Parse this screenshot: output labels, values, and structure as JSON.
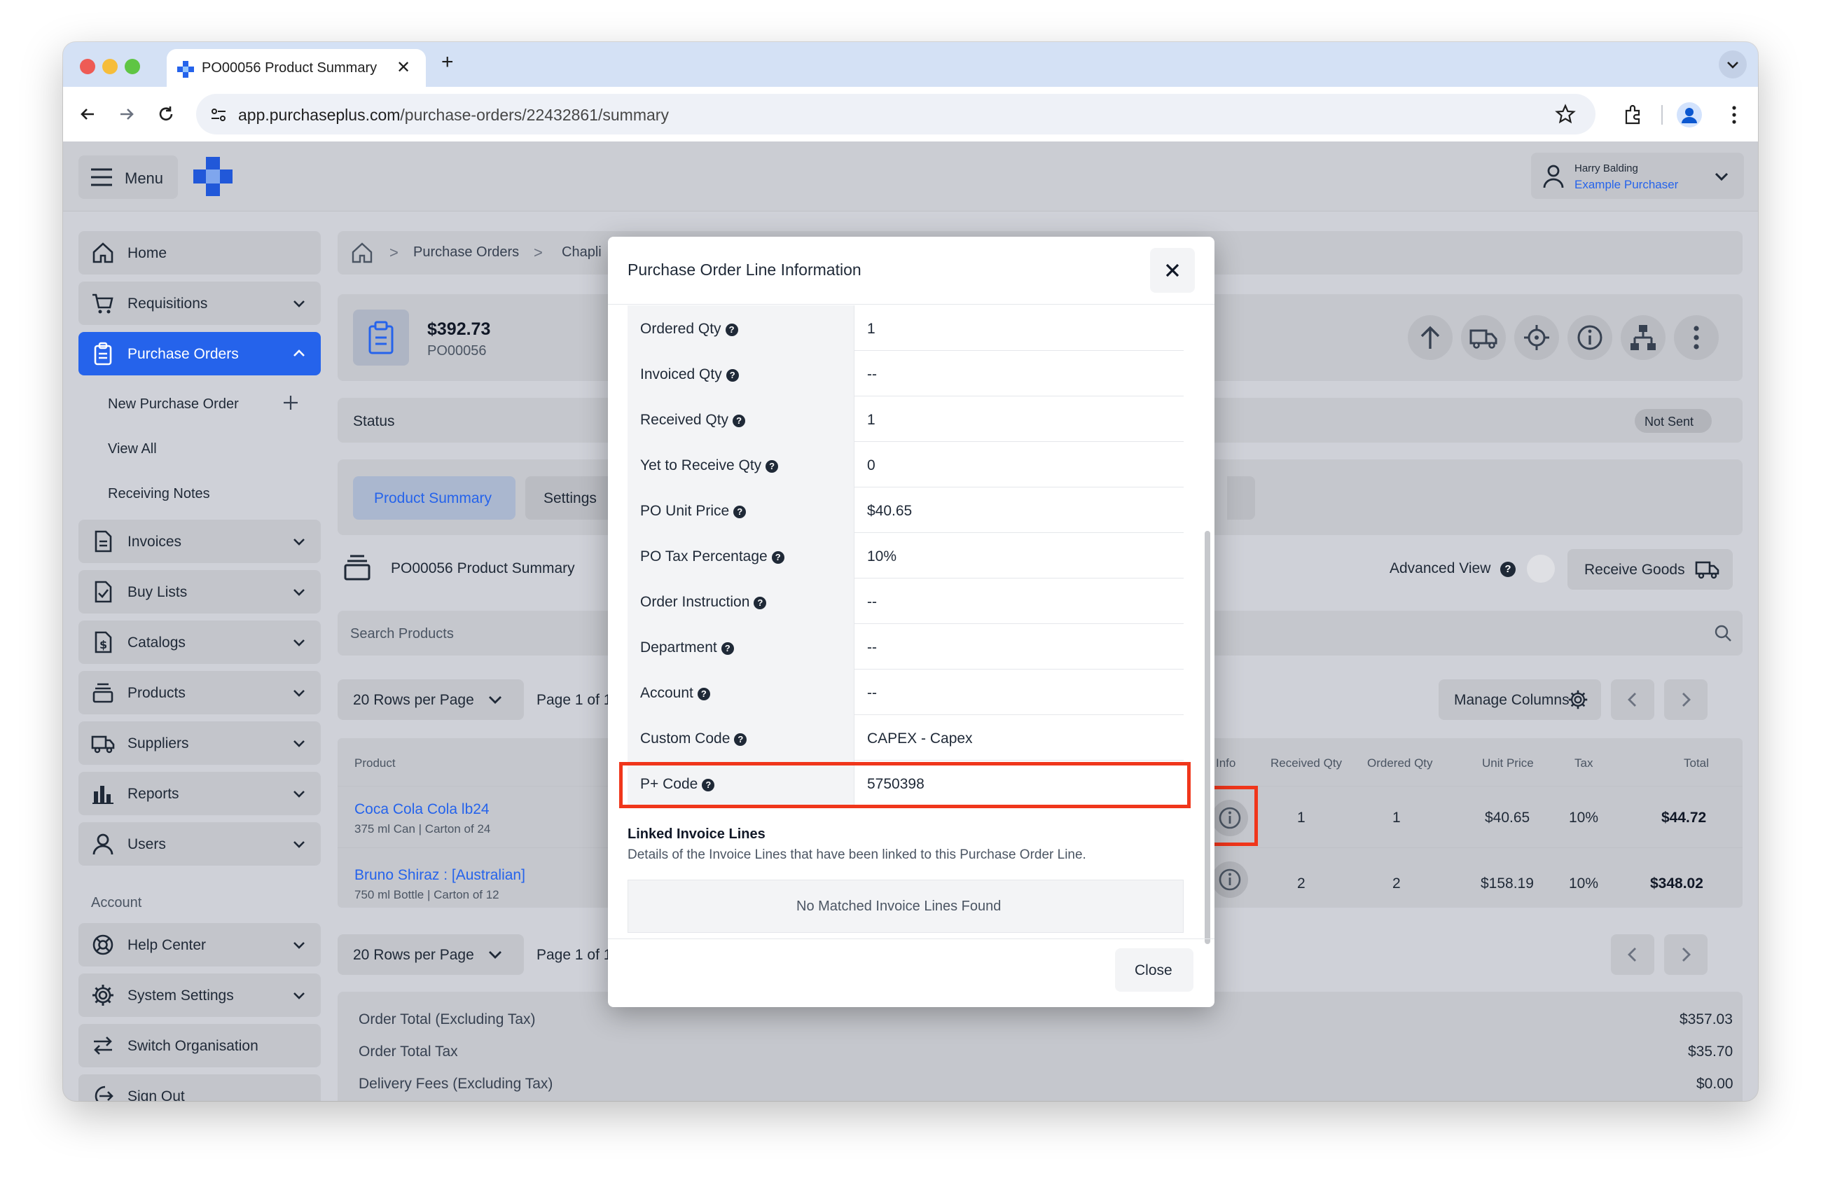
{
  "browser": {
    "tab_title": "PO00056 Product Summary",
    "new_tab": "+",
    "url_domain": "app.purchaseplus.com",
    "url_path": "/purchase-orders/22432861/summary"
  },
  "header": {
    "menu_label": "Menu",
    "user_name": "Harry Balding",
    "user_org": "Example Purchaser"
  },
  "sidebar": {
    "items": [
      {
        "label": "Home"
      },
      {
        "label": "Requisitions"
      },
      {
        "label": "Purchase Orders"
      },
      {
        "label": "Invoices"
      },
      {
        "label": "Buy Lists"
      },
      {
        "label": "Catalogs"
      },
      {
        "label": "Products"
      },
      {
        "label": "Suppliers"
      },
      {
        "label": "Reports"
      },
      {
        "label": "Users"
      }
    ],
    "sub_items": [
      {
        "label": "New Purchase Order"
      },
      {
        "label": "View All"
      },
      {
        "label": "Receiving Notes"
      }
    ],
    "account_heading": "Account",
    "account_items": [
      {
        "label": "Help Center"
      },
      {
        "label": "System Settings"
      },
      {
        "label": "Switch Organisation"
      },
      {
        "label": "Sign Out"
      }
    ]
  },
  "breadcrumb": {
    "items": [
      "Purchase Orders",
      "Chapli"
    ]
  },
  "po": {
    "amount": "$392.73",
    "number": "PO00056",
    "status_label": "Status",
    "status_badge": "Not Sent"
  },
  "tabs": {
    "product_summary": "Product Summary",
    "settings": "Settings"
  },
  "summary": {
    "title": "PO00056 Product Summary",
    "advanced_view": "Advanced View",
    "receive_goods": "Receive Goods",
    "search_placeholder": "Search Products",
    "rows_per_page": "20 Rows per Page",
    "page_info": "Page 1 of 1",
    "manage_columns": "Manage Columns"
  },
  "table": {
    "headers": {
      "product": "Product",
      "info": "Info",
      "received_qty": "Received Qty",
      "ordered_qty": "Ordered Qty",
      "unit_price": "Unit Price",
      "tax": "Tax",
      "total": "Total"
    },
    "rows": [
      {
        "name": "Coca Cola Cola lb24",
        "desc": "375 ml Can | Carton of 24",
        "received": "1",
        "ordered": "1",
        "unit_price": "$40.65",
        "tax": "10%",
        "total": "$44.72"
      },
      {
        "name": "Bruno Shiraz : [Australian]",
        "desc": "750 ml Bottle | Carton of 12",
        "received": "2",
        "ordered": "2",
        "unit_price": "$158.19",
        "tax": "10%",
        "total": "$348.02"
      }
    ]
  },
  "totals": [
    {
      "label": "Order Total (Excluding Tax)",
      "value": "$357.03"
    },
    {
      "label": "Order Total Tax",
      "value": "$35.70"
    },
    {
      "label": "Delivery Fees (Excluding Tax)",
      "value": "$0.00"
    }
  ],
  "modal": {
    "title": "Purchase Order Line Information",
    "rows": [
      {
        "label": "Ordered Qty",
        "value": "1"
      },
      {
        "label": "Invoiced Qty",
        "value": "--"
      },
      {
        "label": "Received Qty",
        "value": "1"
      },
      {
        "label": "Yet to Receive Qty",
        "value": "0"
      },
      {
        "label": "PO Unit Price",
        "value": "$40.65"
      },
      {
        "label": "PO Tax Percentage",
        "value": "10%"
      },
      {
        "label": "Order Instruction",
        "value": "--"
      },
      {
        "label": "Department",
        "value": "--"
      },
      {
        "label": "Account",
        "value": "--"
      },
      {
        "label": "Custom Code",
        "value": "CAPEX - Capex"
      },
      {
        "label": "P+ Code",
        "value": "5750398"
      }
    ],
    "linked_title": "Linked Invoice Lines",
    "linked_desc": "Details of the Invoice Lines that have been linked to this Purchase Order Line.",
    "no_match": "No Matched Invoice Lines Found",
    "close_label": "Close"
  },
  "colors": {
    "brand_blue": "#2563eb",
    "highlight_red": "#f0361b"
  }
}
